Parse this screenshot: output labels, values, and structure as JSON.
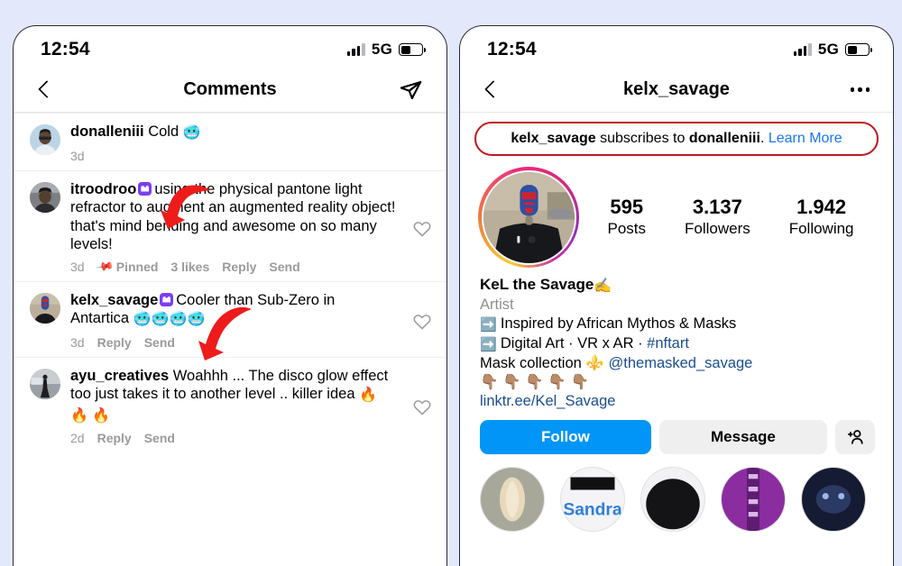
{
  "background_color": "#e4e8fb",
  "accent_blue": "#0095f6",
  "annotation_color": "#ee1b1b",
  "badge_color": "#7b3ff2",
  "left_phone": {
    "status": {
      "time": "12:54",
      "network": "5G",
      "signal_icon": "signal-bars-icon",
      "battery_icon": "battery-icon"
    },
    "nav": {
      "back_icon": "back-chevron-icon",
      "title": "Comments",
      "share_icon": "share-paper-plane-icon"
    },
    "comments": [
      {
        "username": "donalleniii",
        "badge": false,
        "text": "Cold ",
        "emoji": "🥶",
        "time": "3d",
        "pinned": false,
        "pinned_label": "",
        "likes": "",
        "reply_label": "",
        "send_label": "",
        "has_heart": false,
        "avatar_name": "avatar-donalleniii"
      },
      {
        "username": "itroodroo",
        "badge": true,
        "text": "using the physical pantone light refractor to augment an augmented reality object! that's mind bending and awesome on so many levels!",
        "emoji": "",
        "time": "3d",
        "pinned": true,
        "pinned_label": "Pinned",
        "likes": "3 likes",
        "reply_label": "Reply",
        "send_label": "Send",
        "has_heart": true,
        "avatar_name": "avatar-itroodroo"
      },
      {
        "username": "kelx_savage",
        "badge": true,
        "text": "Cooler than Sub-Zero in Antartica ",
        "emoji": "🥶🥶🥶🥶",
        "time": "3d",
        "pinned": false,
        "pinned_label": "",
        "likes": "",
        "reply_label": "Reply",
        "send_label": "Send",
        "has_heart": true,
        "avatar_name": "avatar-kelx-savage"
      },
      {
        "username": "ayu_creatives",
        "badge": false,
        "text": "Woahhh ... The disco glow effect too just takes it to another level .. killer idea ",
        "emoji": "🔥 🔥 🔥",
        "time": "2d",
        "pinned": false,
        "pinned_label": "",
        "likes": "",
        "reply_label": "Reply",
        "send_label": "Send",
        "has_heart": true,
        "avatar_name": "avatar-ayu-creatives"
      }
    ]
  },
  "right_phone": {
    "status": {
      "time": "12:54",
      "network": "5G",
      "signal_icon": "signal-bars-icon",
      "battery_icon": "battery-icon"
    },
    "nav": {
      "back_icon": "back-chevron-icon",
      "title": "kelx_savage",
      "more_icon": "more-options-icon"
    },
    "subscription_banner": {
      "subscriber": "kelx_savage",
      "middle": " subscribes to ",
      "creator": "donalleniii",
      "period": ". ",
      "link": "Learn More"
    },
    "profile": {
      "avatar_name": "profile-avatar",
      "has_story_ring": true,
      "stats": [
        {
          "num": "595",
          "label": "Posts"
        },
        {
          "num": "3.137",
          "label": "Followers"
        },
        {
          "num": "1.942",
          "label": "Following"
        }
      ],
      "display_name": "KeL the Savage",
      "display_name_emoji": "✍️",
      "category": "Artist",
      "bio_lines": [
        {
          "icon": "➡️",
          "text": "Inspired by African Mythos & Masks",
          "tail": "",
          "tail_blue": ""
        },
        {
          "icon": "➡️",
          "text": "Digital Art · VR x AR · ",
          "tail": "",
          "tail_blue": "#nftart"
        },
        {
          "icon": "",
          "text": "Mask collection ⚜️ ",
          "tail": "",
          "tail_blue": "@themasked_savage"
        },
        {
          "icon": "",
          "text": "👇🏽 👇🏽 👇🏽 👇🏽 👇🏽",
          "tail": "",
          "tail_blue": ""
        }
      ],
      "website": "linktr.ee/Kel_Savage",
      "buttons": {
        "follow": "Follow",
        "message": "Message",
        "add_user_icon": "add-person-icon"
      },
      "highlights_count": 5
    }
  }
}
